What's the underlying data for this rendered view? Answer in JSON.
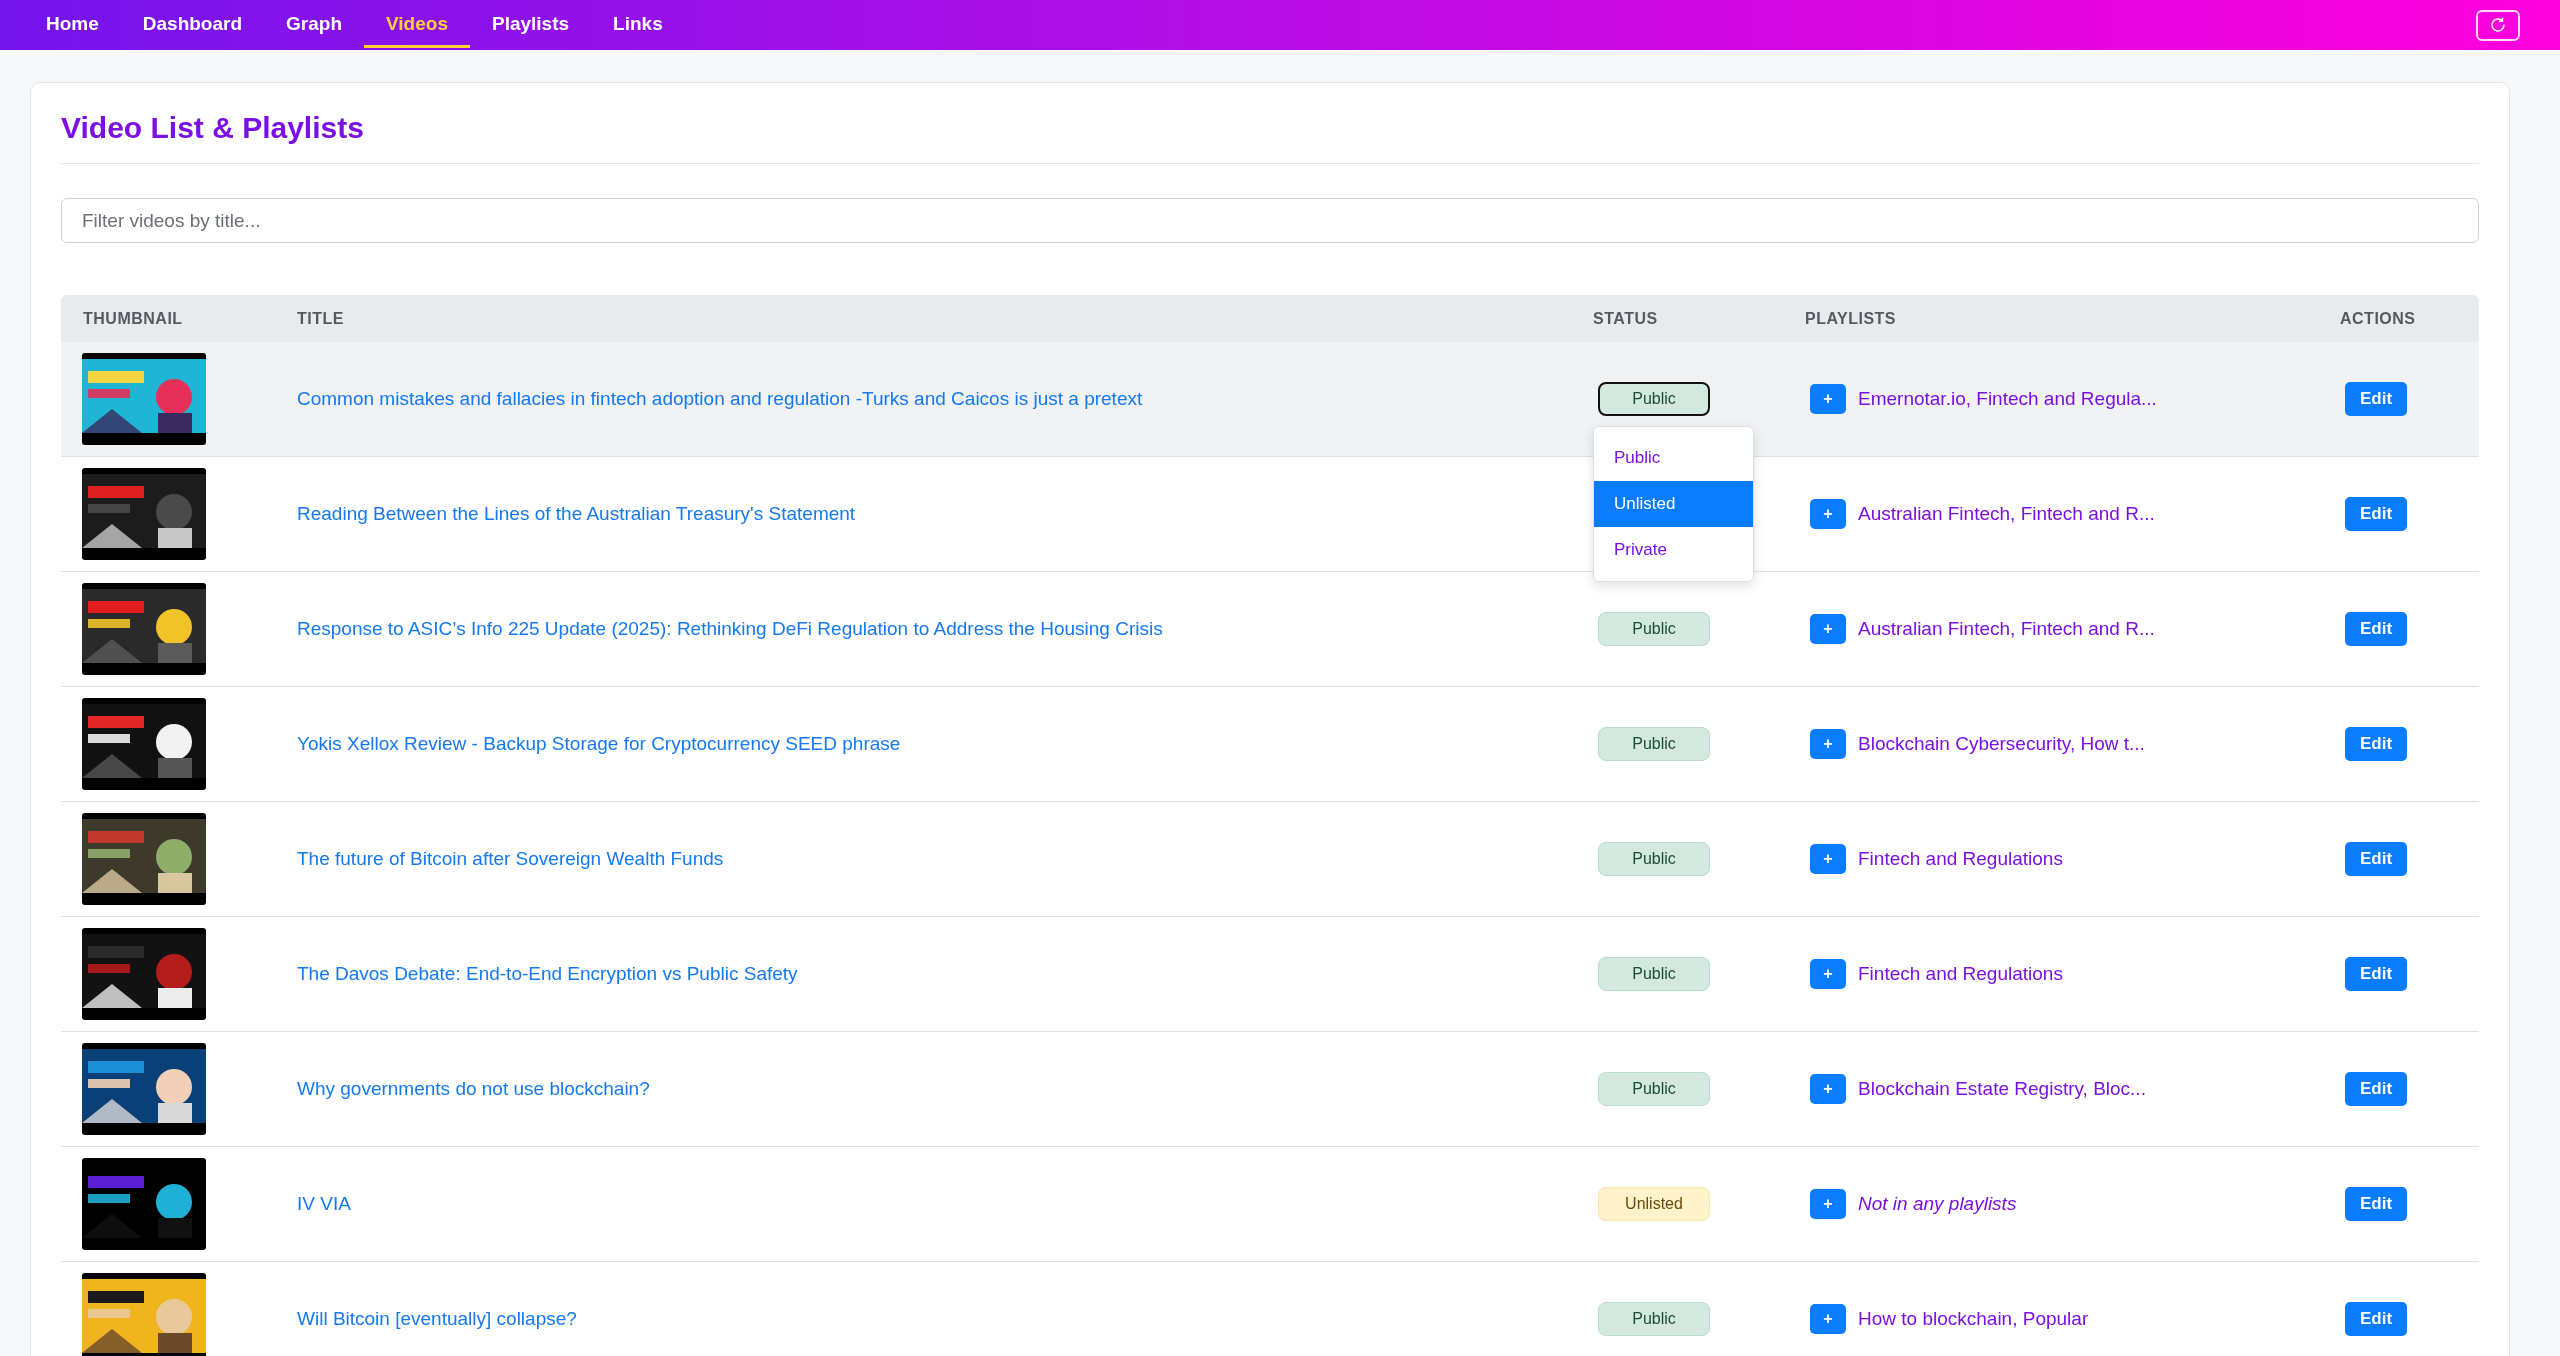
{
  "nav": {
    "tabs": [
      {
        "label": "Home",
        "selected": false
      },
      {
        "label": "Dashboard",
        "selected": false
      },
      {
        "label": "Graph",
        "selected": false
      },
      {
        "label": "Videos",
        "selected": true
      },
      {
        "label": "Playlists",
        "selected": false
      },
      {
        "label": "Links",
        "selected": false
      }
    ]
  },
  "page": {
    "title": "Video List & Playlists",
    "filter": {
      "placeholder": "Filter videos by title..."
    }
  },
  "table": {
    "columns": [
      "THUMBNAIL",
      "TITLE",
      "STATUS",
      "PLAYLISTS",
      "ACTIONS"
    ],
    "rows": [
      {
        "title": "Common mistakes and fallacies in fintech adoption and regulation -Turks and Caicos is just a pretext",
        "status": {
          "label": "Public",
          "kind": "public",
          "open": true
        },
        "highlighted": true,
        "playlists": {
          "text": "Emernotar.io, Fintech and Regula...",
          "kind": "list"
        },
        "action": "Edit",
        "add": "+"
      },
      {
        "title": "Reading Between the Lines of the Australian Treasury's Statement",
        "highlighted": false,
        "playlists": {
          "text": "Australian Fintech, Fintech and R...",
          "kind": "list"
        },
        "action": "Edit",
        "add": "+"
      },
      {
        "title": "Response to ASIC’s Info 225 Update (2025): Rethinking DeFi Regulation to Address the Housing Crisis",
        "status": {
          "label": "Public",
          "kind": "public",
          "open": false
        },
        "highlighted": false,
        "playlists": {
          "text": "Australian Fintech, Fintech and R...",
          "kind": "list"
        },
        "action": "Edit",
        "add": "+"
      },
      {
        "title": "Yokis Xellox Review - Backup Storage for Cryptocurrency SEED phrase",
        "status": {
          "label": "Public",
          "kind": "public",
          "open": false
        },
        "highlighted": false,
        "playlists": {
          "text": "Blockchain Cybersecurity, How t...",
          "kind": "list"
        },
        "action": "Edit",
        "add": "+"
      },
      {
        "title": "The future of Bitcoin after Sovereign Wealth Funds",
        "status": {
          "label": "Public",
          "kind": "public",
          "open": false
        },
        "highlighted": false,
        "playlists": {
          "text": "Fintech and Regulations",
          "kind": "list"
        },
        "action": "Edit",
        "add": "+"
      },
      {
        "title": "The Davos Debate: End-to-End Encryption vs Public Safety",
        "status": {
          "label": "Public",
          "kind": "public",
          "open": false
        },
        "highlighted": false,
        "playlists": {
          "text": "Fintech and Regulations",
          "kind": "list"
        },
        "action": "Edit",
        "add": "+"
      },
      {
        "title": "Why governments do not use blockchain?",
        "status": {
          "label": "Public",
          "kind": "public",
          "open": false
        },
        "highlighted": false,
        "playlists": {
          "text": "Blockchain Estate Registry, Bloc...",
          "kind": "list"
        },
        "action": "Edit",
        "add": "+"
      },
      {
        "title": "IV VIA",
        "status": {
          "label": "Unlisted",
          "kind": "unlisted",
          "open": false
        },
        "highlighted": false,
        "playlists": {
          "text": "Not in any playlists",
          "kind": "none"
        },
        "action": "Edit",
        "add": "+"
      },
      {
        "title": "Will Bitcoin [eventually] collapse?",
        "status": {
          "label": "Public",
          "kind": "public",
          "open": false
        },
        "highlighted": false,
        "playlists": {
          "text": "How to blockchain, Popular",
          "kind": "list"
        },
        "action": "Edit",
        "add": "+"
      }
    ]
  },
  "status_menu": {
    "options": [
      {
        "label": "Public",
        "selected": false
      },
      {
        "label": "Unlisted",
        "selected": true
      },
      {
        "label": "Private",
        "selected": false
      }
    ]
  }
}
